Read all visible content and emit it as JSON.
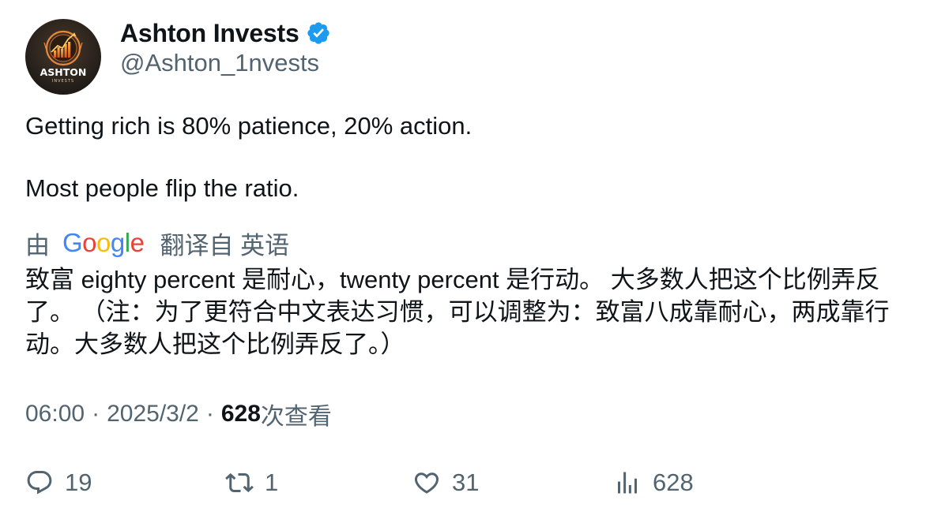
{
  "author": {
    "display_name": "Ashton Invests",
    "handle": "@Ashton_1nvests",
    "verified": true,
    "avatar_text": "ASHTON",
    "avatar_subtext": "INVESTS"
  },
  "tweet": {
    "paragraphs": [
      "Getting rich is 80% patience, 20% action.",
      "Most people flip the ratio."
    ]
  },
  "translation": {
    "prefix": "由",
    "provider": "Google",
    "label": "翻译自 英语",
    "text": "致富 eighty percent 是耐心，twenty percent 是行动。 大多数人把这个比例弄反了。 （注：为了更符合中文表达习惯，可以调整为：致富八成靠耐心，两成靠行动。大多数人把这个比例弄反了。）"
  },
  "meta": {
    "time": "06:00",
    "separator": "·",
    "date": "2025/3/2",
    "views_count": "628",
    "views_label": "次查看"
  },
  "actions": {
    "replies": "19",
    "retweets": "1",
    "likes": "31",
    "views": "628"
  },
  "colors": {
    "text": "#0f1419",
    "secondary": "#536471",
    "verified": "#1d9bf0"
  }
}
